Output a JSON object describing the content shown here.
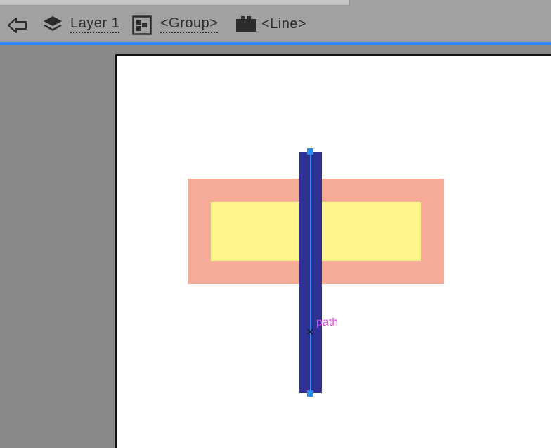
{
  "breadcrumb": {
    "back_icon": "back-arrow-icon",
    "layer_icon": "layers-icon",
    "layer_label": "Layer 1",
    "group_icon": "group-icon",
    "group_label": "<Group>",
    "line_icon": "line-object-icon",
    "line_label": "<Line>"
  },
  "canvas": {
    "path_label": "path",
    "colors": {
      "outer_rect": "#f7ac9a",
      "inner_rect": "#fff58d",
      "vertical_bar": "#2e3192",
      "selection": "#2a8af0",
      "path_label": "#ee44ee",
      "accent_bar": "#2a8af0"
    }
  }
}
